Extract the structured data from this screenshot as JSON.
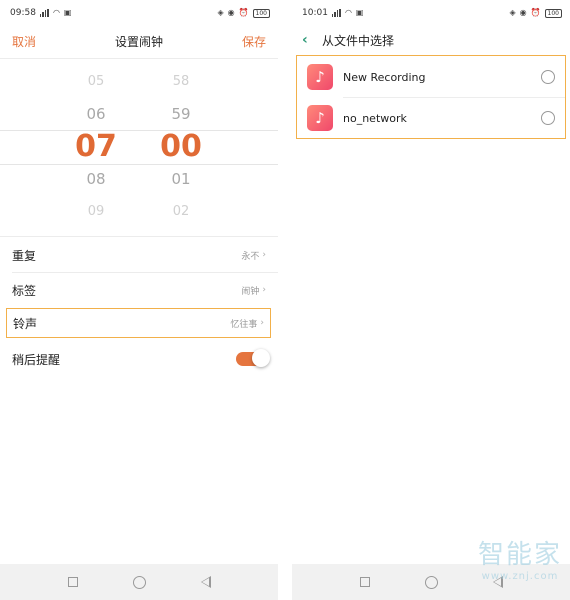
{
  "left": {
    "status": {
      "time": "09:58",
      "battery": "100"
    },
    "header": {
      "cancel": "取消",
      "title": "设置闹钟",
      "save": "保存"
    },
    "picker": {
      "hours": [
        "05",
        "06",
        "07",
        "08",
        "09"
      ],
      "minutes": [
        "58",
        "59",
        "00",
        "01",
        "02"
      ],
      "selected_hour": "07",
      "selected_minute": "00"
    },
    "settings": [
      {
        "label": "重复",
        "value": "永不"
      },
      {
        "label": "标签",
        "value": "闹钟"
      },
      {
        "label": "铃声",
        "value": "忆往事"
      },
      {
        "label": "稍后提醒",
        "toggle": true
      }
    ]
  },
  "right": {
    "status": {
      "time": "10:01",
      "battery": "100"
    },
    "header": {
      "title": "从文件中选择"
    },
    "files": [
      {
        "name": "New Recording"
      },
      {
        "name": "no_network"
      }
    ]
  },
  "watermark": {
    "title": "智能家",
    "url": "www.znj.com"
  },
  "colors": {
    "accent": "#e5753f",
    "highlight": "#f2b04a",
    "back": "#2e9a78"
  }
}
